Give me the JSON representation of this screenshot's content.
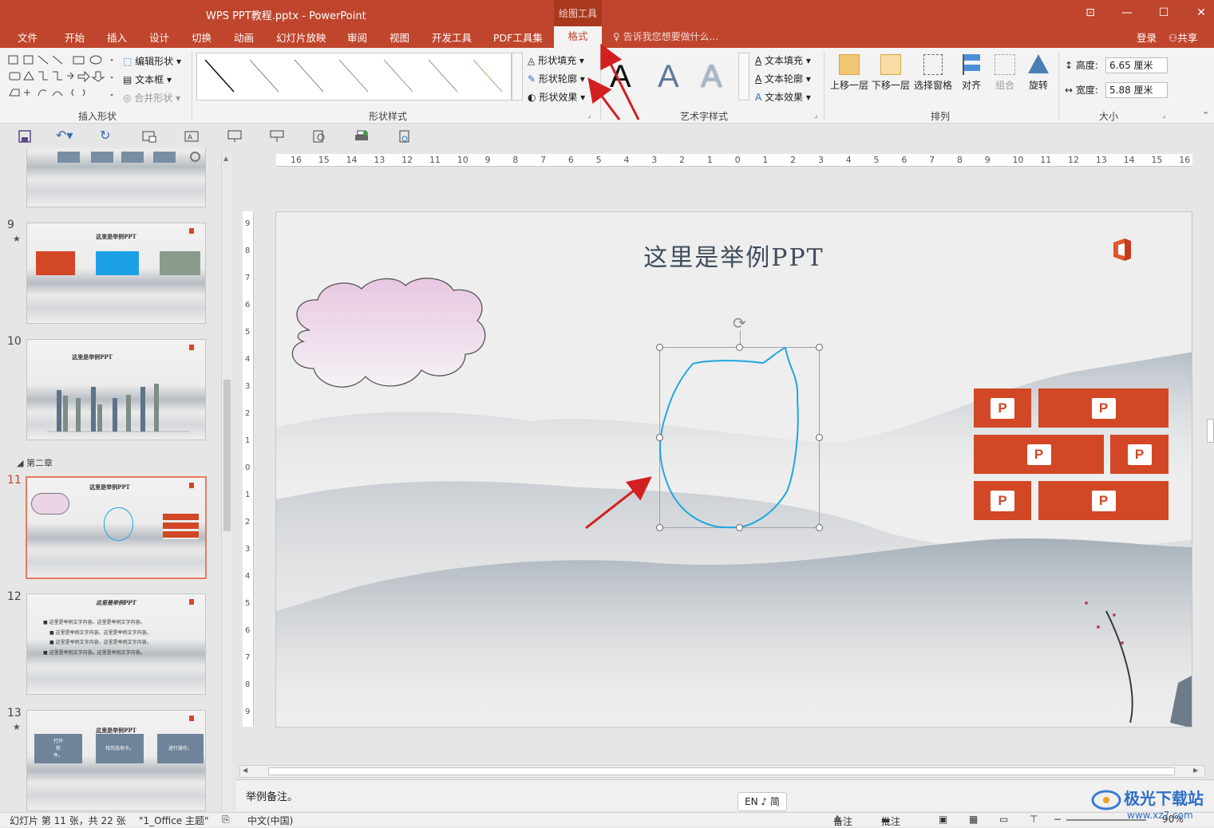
{
  "window": {
    "title": "WPS PPT教程.pptx - PowerPoint",
    "context_group": "绘图工具",
    "controls": [
      "⊡",
      "—",
      "☐",
      "✕"
    ]
  },
  "tabs": [
    "文件",
    "开始",
    "插入",
    "设计",
    "切换",
    "动画",
    "幻灯片放映",
    "审阅",
    "视图",
    "开发工具",
    "PDF工具集"
  ],
  "active_tab": "格式",
  "tell_me": "告诉我您想要做什么...",
  "account": {
    "login": "登录",
    "share": "共享"
  },
  "ribbon": {
    "insert_shape": {
      "label": "插入形状",
      "edit_shape": "编辑形状",
      "text_box": "文本框",
      "merge_shapes": "合并形状"
    },
    "shape_styles": {
      "label": "形状样式",
      "fill": "形状填充",
      "outline": "形状轮廓",
      "effect": "形状效果"
    },
    "wordart": {
      "label": "艺术字样式",
      "samples": [
        "A",
        "A",
        "A"
      ],
      "text_fill": "文本填充",
      "text_outline": "文本轮廓",
      "text_effect": "文本效果"
    },
    "arrange": {
      "label": "排列",
      "bring_forward": "上移一层",
      "send_backward": "下移一层",
      "selection_pane": "选择窗格",
      "align": "对齐",
      "group": "组合",
      "rotate": "旋转"
    },
    "size": {
      "label": "大小",
      "height_label": "高度:",
      "height_value": "6.65 厘米",
      "width_label": "宽度:",
      "width_value": "5.88 厘米"
    }
  },
  "outline": {
    "section": "第二章",
    "slides": [
      {
        "num": "9",
        "starred": true,
        "title": "这里是举例PPT"
      },
      {
        "num": "10",
        "starred": false,
        "title": "这里是举例PPT"
      },
      {
        "num": "11",
        "starred": false,
        "title": "这里是举例PPT",
        "selected": true
      },
      {
        "num": "12",
        "starred": false,
        "title": "这里是举例PPT",
        "bullets": [
          "这里是举例文字内容。这里是举例文字内容。",
          "这里是举例文字内容。这里是举例文字内容。",
          "这里是举例文字内容。这里是举例文字内容。",
          "这里是举例文字内容。这里是举例文字内容。"
        ]
      },
      {
        "num": "13",
        "starred": true,
        "title": "这里是举例PPT",
        "boxes": [
          "打开\n软\n件。",
          "找到选项卡。",
          "进行操作。"
        ]
      }
    ]
  },
  "slide": {
    "title": "这里是举例PPT"
  },
  "ruler_numbers": [
    "16",
    "15",
    "14",
    "13",
    "12",
    "11",
    "10",
    "9",
    "8",
    "7",
    "6",
    "5",
    "4",
    "3",
    "2",
    "1",
    "0",
    "1",
    "2",
    "3",
    "4",
    "5",
    "6",
    "7",
    "8",
    "9",
    "10",
    "11",
    "12",
    "13",
    "14",
    "15",
    "16"
  ],
  "vruler_numbers": [
    "9",
    "8",
    "7",
    "6",
    "5",
    "4",
    "3",
    "2",
    "1",
    "0",
    "1",
    "2",
    "3",
    "4",
    "5",
    "6",
    "7",
    "8",
    "9"
  ],
  "notes": "举例备注。",
  "ime": "EN ♪ 简",
  "status": {
    "slide_info": "幻灯片 第 11 张，共 22 张",
    "theme": "\"1_Office 主题\"",
    "language": "中文(中国)",
    "notes_btn": "备注",
    "comments_btn": "批注",
    "zoom": "90%"
  },
  "watermark": {
    "text": "极光下载站",
    "url": "www.xz7.com"
  },
  "colors": {
    "accent": "#c0452d",
    "ppt_tile": "#d24726",
    "freeform_stroke": "#1ea7e1",
    "annotation_arrow": "#d22020"
  }
}
